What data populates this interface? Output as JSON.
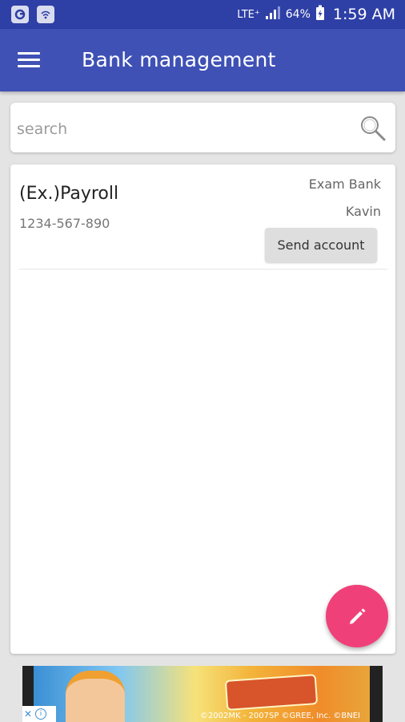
{
  "status_bar": {
    "network": "LTE⁺",
    "battery": "64%",
    "time": "1:59 AM"
  },
  "app_bar": {
    "title": "Bank management"
  },
  "search": {
    "placeholder": "search"
  },
  "accounts": [
    {
      "name": "(Ex.)Payroll",
      "number": "1234-567-890",
      "bank": "Exam Bank",
      "holder": "Kavin",
      "action_label": "Send account"
    }
  ],
  "ad": {
    "copyright": "©2002MK - 2007SP ©GREE, Inc. ©BNEI",
    "close_label": "✕"
  },
  "icons": {
    "menu": "menu-icon",
    "search": "search-icon",
    "edit": "pencil-icon"
  },
  "colors": {
    "primary": "#3f51b5",
    "status_bar": "#2e3fa6",
    "accent": "#f0407a"
  }
}
